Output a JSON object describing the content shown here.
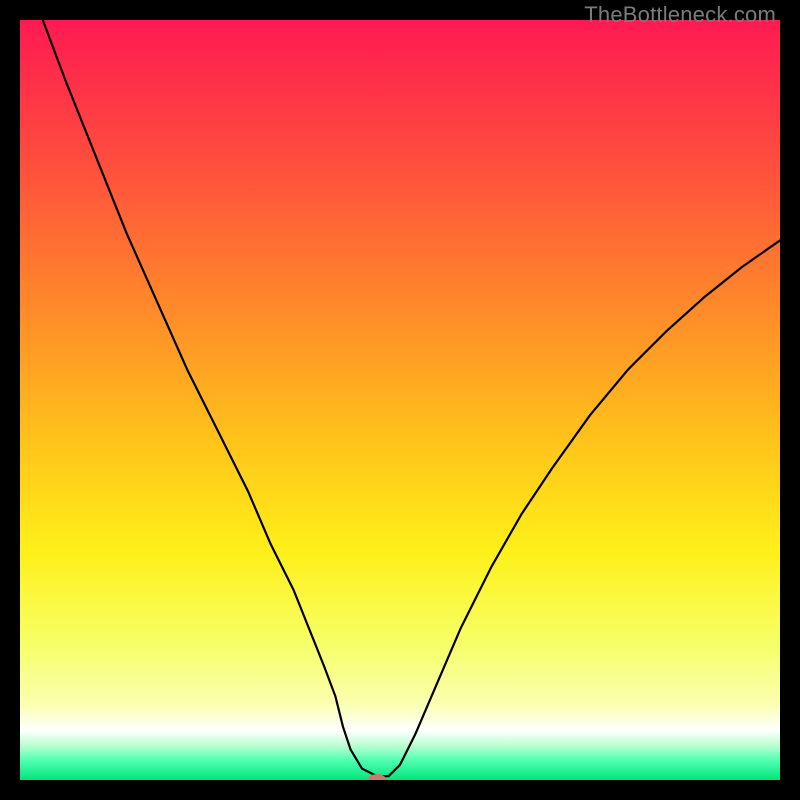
{
  "watermark": "TheBottleneck.com",
  "chart_data": {
    "type": "line",
    "title": "",
    "xlabel": "",
    "ylabel": "",
    "xlim": [
      0,
      100
    ],
    "ylim": [
      0,
      100
    ],
    "grid": false,
    "legend": false,
    "background_gradient": {
      "stops": [
        {
          "pos": 0.0,
          "color": "#ff1a52"
        },
        {
          "pos": 0.18,
          "color": "#ff4b3e"
        },
        {
          "pos": 0.38,
          "color": "#ff8a2a"
        },
        {
          "pos": 0.55,
          "color": "#ffc21a"
        },
        {
          "pos": 0.7,
          "color": "#fff01a"
        },
        {
          "pos": 0.82,
          "color": "#f6ff66"
        },
        {
          "pos": 0.9,
          "color": "#fbffb0"
        },
        {
          "pos": 0.935,
          "color": "#ffffff"
        },
        {
          "pos": 0.955,
          "color": "#b8ffd0"
        },
        {
          "pos": 0.975,
          "color": "#4dffb0"
        },
        {
          "pos": 1.0,
          "color": "#00e57a"
        }
      ]
    },
    "series": [
      {
        "name": "bottleneck-curve",
        "color": "#000000",
        "x": [
          3.0,
          6.0,
          10.0,
          14.0,
          18.0,
          22.0,
          26.0,
          30.0,
          33.0,
          36.0,
          38.0,
          40.0,
          41.5,
          42.5,
          43.5,
          45.0,
          47.0,
          48.5,
          50.0,
          52.0,
          55.0,
          58.0,
          62.0,
          66.0,
          70.0,
          75.0,
          80.0,
          85.0,
          90.0,
          95.0,
          100.0
        ],
        "y": [
          100.0,
          92.0,
          82.0,
          72.0,
          63.0,
          54.0,
          46.0,
          38.0,
          31.0,
          25.0,
          20.0,
          15.0,
          11.0,
          7.0,
          4.0,
          1.5,
          0.5,
          0.5,
          2.0,
          6.0,
          13.0,
          20.0,
          28.0,
          35.0,
          41.0,
          48.0,
          54.0,
          59.0,
          63.5,
          67.5,
          71.0
        ]
      }
    ],
    "marker": {
      "name": "optimal-point",
      "x": 47.0,
      "y": 0.0,
      "color": "#c97b6d",
      "rx": 9,
      "ry": 6
    }
  }
}
